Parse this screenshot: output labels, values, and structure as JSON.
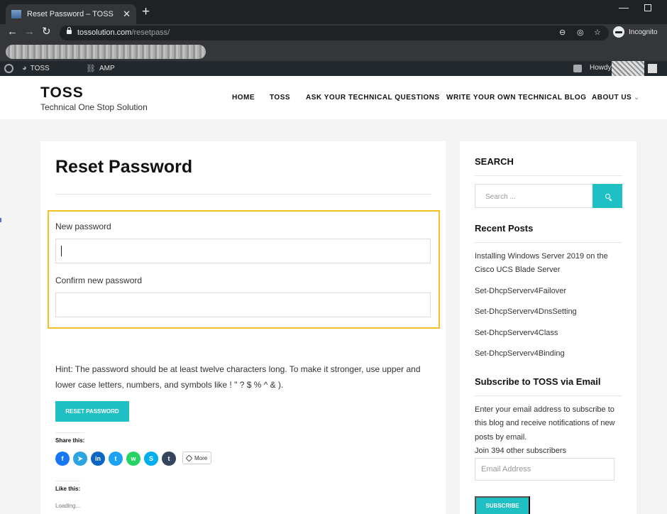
{
  "browser": {
    "tab_title": "Reset Password – TOSS",
    "tab_close": "✕",
    "new_tab": "+",
    "url_domain": "tossolution.com",
    "url_path": "/resetpass/",
    "incognito_label": "Incognito"
  },
  "adminbar": {
    "site_label": "TOSS",
    "amp_label": "AMP",
    "howdy": "Howdy,"
  },
  "site": {
    "title": "TOSS",
    "tagline": "Technical One Stop Solution",
    "nav": [
      "HOME",
      "TOSS",
      "ASK YOUR TECHNICAL QUESTIONS",
      "WRITE YOUR OWN TECHNICAL BLOG",
      "ABOUT US"
    ]
  },
  "main": {
    "page_title": "Reset Password",
    "new_password_label": "New password",
    "confirm_password_label": "Confirm new password",
    "hint": "Hint: The password should be at least twelve characters long. To make it stronger, use upper and lower case letters, numbers, and symbols like ! \" ? $ % ^ & ).",
    "reset_button": "RESET PASSWORD",
    "share_label": "Share this:",
    "social": [
      {
        "name": "facebook-icon",
        "glyph": "f",
        "color": "#1877f2"
      },
      {
        "name": "telegram-icon",
        "glyph": "➤",
        "color": "#2ca5e0"
      },
      {
        "name": "linkedin-icon",
        "glyph": "in",
        "color": "#0a66c2"
      },
      {
        "name": "twitter-icon",
        "glyph": "t",
        "color": "#1da1f2"
      },
      {
        "name": "whatsapp-icon",
        "glyph": "w",
        "color": "#25d366"
      },
      {
        "name": "skype-icon",
        "glyph": "S",
        "color": "#00aff0"
      },
      {
        "name": "tumblr-icon",
        "glyph": "t",
        "color": "#35465c"
      }
    ],
    "more_label": "More",
    "like_label": "Like this:",
    "loading": "Loading..."
  },
  "sidebar": {
    "search_title": "SEARCH",
    "search_placeholder": "Search ...",
    "recent_title": "Recent Posts",
    "recent_posts": [
      "Installing Windows Server 2019 on the Cisco UCS Blade Server",
      "Set-DhcpServerv4Failover",
      "Set-DhcpServerv4DnsSetting",
      "Set-DhcpServerv4Class",
      "Set-DhcpServerv4Binding"
    ],
    "subscribe_title": "Subscribe to TOSS via Email",
    "subscribe_text": "Enter your email address to subscribe to this blog and receive notifications of new posts by email.",
    "subscribers_text": "Join 394 other subscribers",
    "email_placeholder": "Email Address",
    "subscribe_button": "SUBSCRIBE"
  },
  "colors": {
    "accent": "#1fc0c4",
    "highlight_border": "#f4c025",
    "chrome_dark": "#202124",
    "adminbar": "#23282d"
  }
}
